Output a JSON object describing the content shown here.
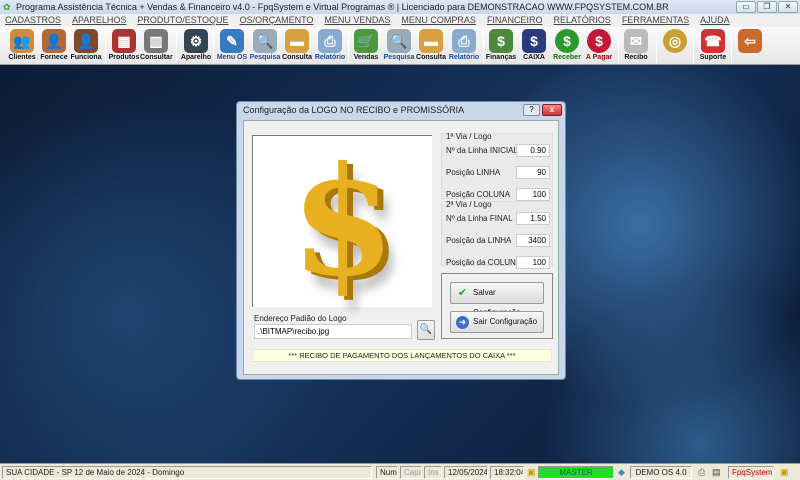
{
  "window": {
    "title": "Programa Assistência Técnica + Vendas & Financeiro v4.0 - FpqSystem e Virtual Programas ® | Licenciado para  DEMONSTRACAO WWW.FPQSYSTEM.COM.BR",
    "minimize": "▭",
    "restore": "❐",
    "close": "✕"
  },
  "menu": [
    "CADASTROS",
    "APARELHOS",
    "PRODUTO/ESTOQUE",
    "OS/ORÇAMENTO",
    "MENU VENDAS",
    "MENU COMPRAS",
    "FINANCEIRO",
    "RELATÓRIOS",
    "FERRAMENTAS",
    "AJUDA"
  ],
  "toolbar": [
    {
      "label": "Clientes",
      "icon": "users-icon",
      "color": "#d08a3a",
      "glyph": "👥"
    },
    {
      "label": "Fornece",
      "icon": "supplier-icon",
      "color": "#b06a3a",
      "glyph": "👤"
    },
    {
      "label": "Funciona",
      "icon": "employee-icon",
      "color": "#7a4a2a",
      "glyph": "👤"
    },
    {
      "label": "Produtos",
      "icon": "cart-products-icon",
      "color": "#a33",
      "glyph": "▦"
    },
    {
      "label": "Consultar",
      "icon": "barcode-icon",
      "color": "#777",
      "glyph": "▥"
    },
    {
      "label": "Aparelho",
      "icon": "device-icon",
      "color": "#345",
      "glyph": "⚙"
    },
    {
      "label": "Menu OS",
      "icon": "clipboard-icon",
      "color": "#3a7abf",
      "glyph": "✎"
    },
    {
      "label": "Pesquisa",
      "icon": "search-doc-icon",
      "color": "#9ab",
      "glyph": "🔍"
    },
    {
      "label": "Consulta",
      "icon": "file-box-icon",
      "color": "#d9a040",
      "glyph": "▬"
    },
    {
      "label": "Relatório",
      "icon": "printer-icon",
      "color": "#8ac",
      "glyph": "⎙"
    },
    {
      "label": "Vendas",
      "icon": "sales-cart-icon",
      "color": "#4a9a3a",
      "glyph": "🛒"
    },
    {
      "label": "Pesquisa",
      "icon": "search-doc-icon",
      "color": "#9ab",
      "glyph": "🔍"
    },
    {
      "label": "Consulta",
      "icon": "file-box-icon",
      "color": "#d9a040",
      "glyph": "▬"
    },
    {
      "label": "Relatório",
      "icon": "printer-icon",
      "color": "#8ac",
      "glyph": "⎙"
    },
    {
      "label": "Finanças",
      "icon": "finance-chart-icon",
      "color": "#4a8a3a",
      "glyph": "$"
    },
    {
      "label": "CAIXA",
      "icon": "cash-book-icon",
      "color": "#2a3a7a",
      "glyph": "$"
    },
    {
      "label": "Receber",
      "icon": "receive-money-icon",
      "color": "#2a9a2a",
      "glyph": "$"
    },
    {
      "label": "A Pagar",
      "icon": "pay-money-icon",
      "color": "#c2183a",
      "glyph": "$"
    },
    {
      "label": "Recibo",
      "icon": "receipt-icon",
      "color": "#bbb",
      "glyph": "✉"
    },
    {
      "label": "",
      "icon": "coins-icon",
      "color": "#c9a030",
      "glyph": "◎"
    },
    {
      "label": "Suporte",
      "icon": "support-icon",
      "color": "#c33",
      "glyph": "☎"
    },
    {
      "label": "",
      "icon": "exit-door-icon",
      "color": "#c96a2a",
      "glyph": "⇦"
    }
  ],
  "dialog": {
    "title": "Configuração da LOGO NO RECIBO e PROMISSÓRIA",
    "help": "?",
    "close": "x",
    "logo_symbol": "$",
    "via1": {
      "title": "1ª Via / Logo",
      "fields": [
        {
          "label": "Nº da Linha INICIAL",
          "value": "0.90"
        },
        {
          "label": "Posição LINHA",
          "value": "90"
        },
        {
          "label": "Posição COLUNA",
          "value": "100"
        }
      ]
    },
    "via2": {
      "title": "2ª Via / Logo",
      "fields": [
        {
          "label": "Nº da Linha FINAL",
          "value": "1.50"
        },
        {
          "label": "Posição da LINHA",
          "value": "3400"
        },
        {
          "label": "Posição da COLUNA",
          "value": "100"
        }
      ]
    },
    "save_label": "Salvar Configuração",
    "exit_label": "Sair Configuração",
    "path_label": "Endereço Padião do Logo",
    "path_value": ".\\BITMAP\\recibo.jpg",
    "footer": "*** RECIBO DE PAGAMENTO DOS LANÇAMENTOS DO CAIXA ***"
  },
  "status": {
    "city": "SUA CIDADE - SP 12 de Maio de 2024 - Domingo",
    "num": "Num",
    "caps": "Caps",
    "ins": "Ins",
    "date": "12/05/2024",
    "time": "18:32:04",
    "user": "MASTER",
    "version": "DEMO OS 4.0",
    "brand": "FpqSystem",
    "user_color": "#22dd22"
  }
}
